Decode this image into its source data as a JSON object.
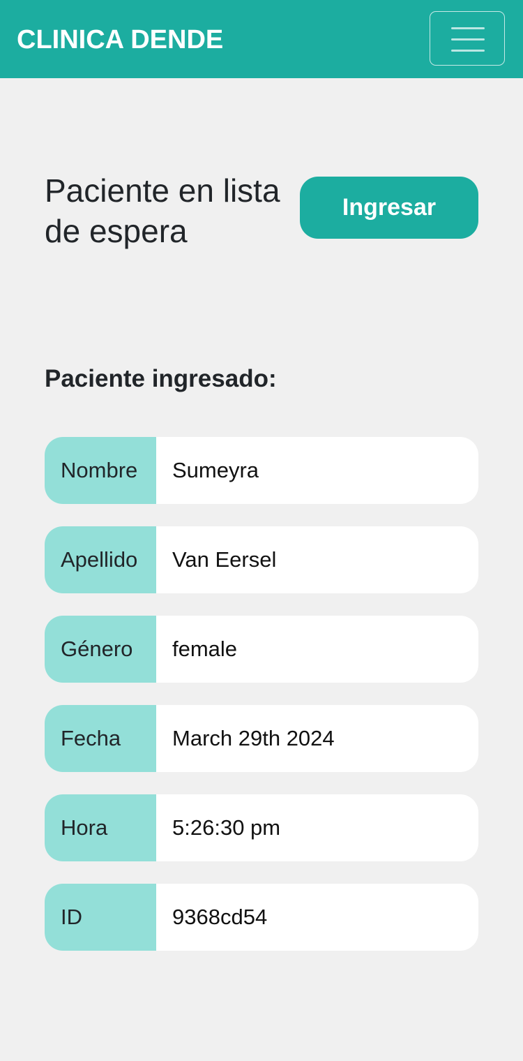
{
  "navbar": {
    "brand": "CLINICA DENDE",
    "toggler_icon": "hamburger-menu-icon"
  },
  "waiting": {
    "title": "Paciente en lista de espera",
    "button_label": "Ingresar"
  },
  "patient": {
    "section_title": "Paciente ingresado:",
    "fields": [
      {
        "label": "Nombre",
        "value": "Sumeyra"
      },
      {
        "label": "Apellido",
        "value": "Van Eersel"
      },
      {
        "label": "Género",
        "value": "female"
      },
      {
        "label": "Fecha",
        "value": "March 29th 2024"
      },
      {
        "label": "Hora",
        "value": "5:26:30 pm"
      },
      {
        "label": "ID",
        "value": "9368cd54"
      }
    ]
  },
  "colors": {
    "primary": "#1cada0",
    "label_bg": "#93dfd8",
    "page_bg": "#f0f0f0"
  }
}
